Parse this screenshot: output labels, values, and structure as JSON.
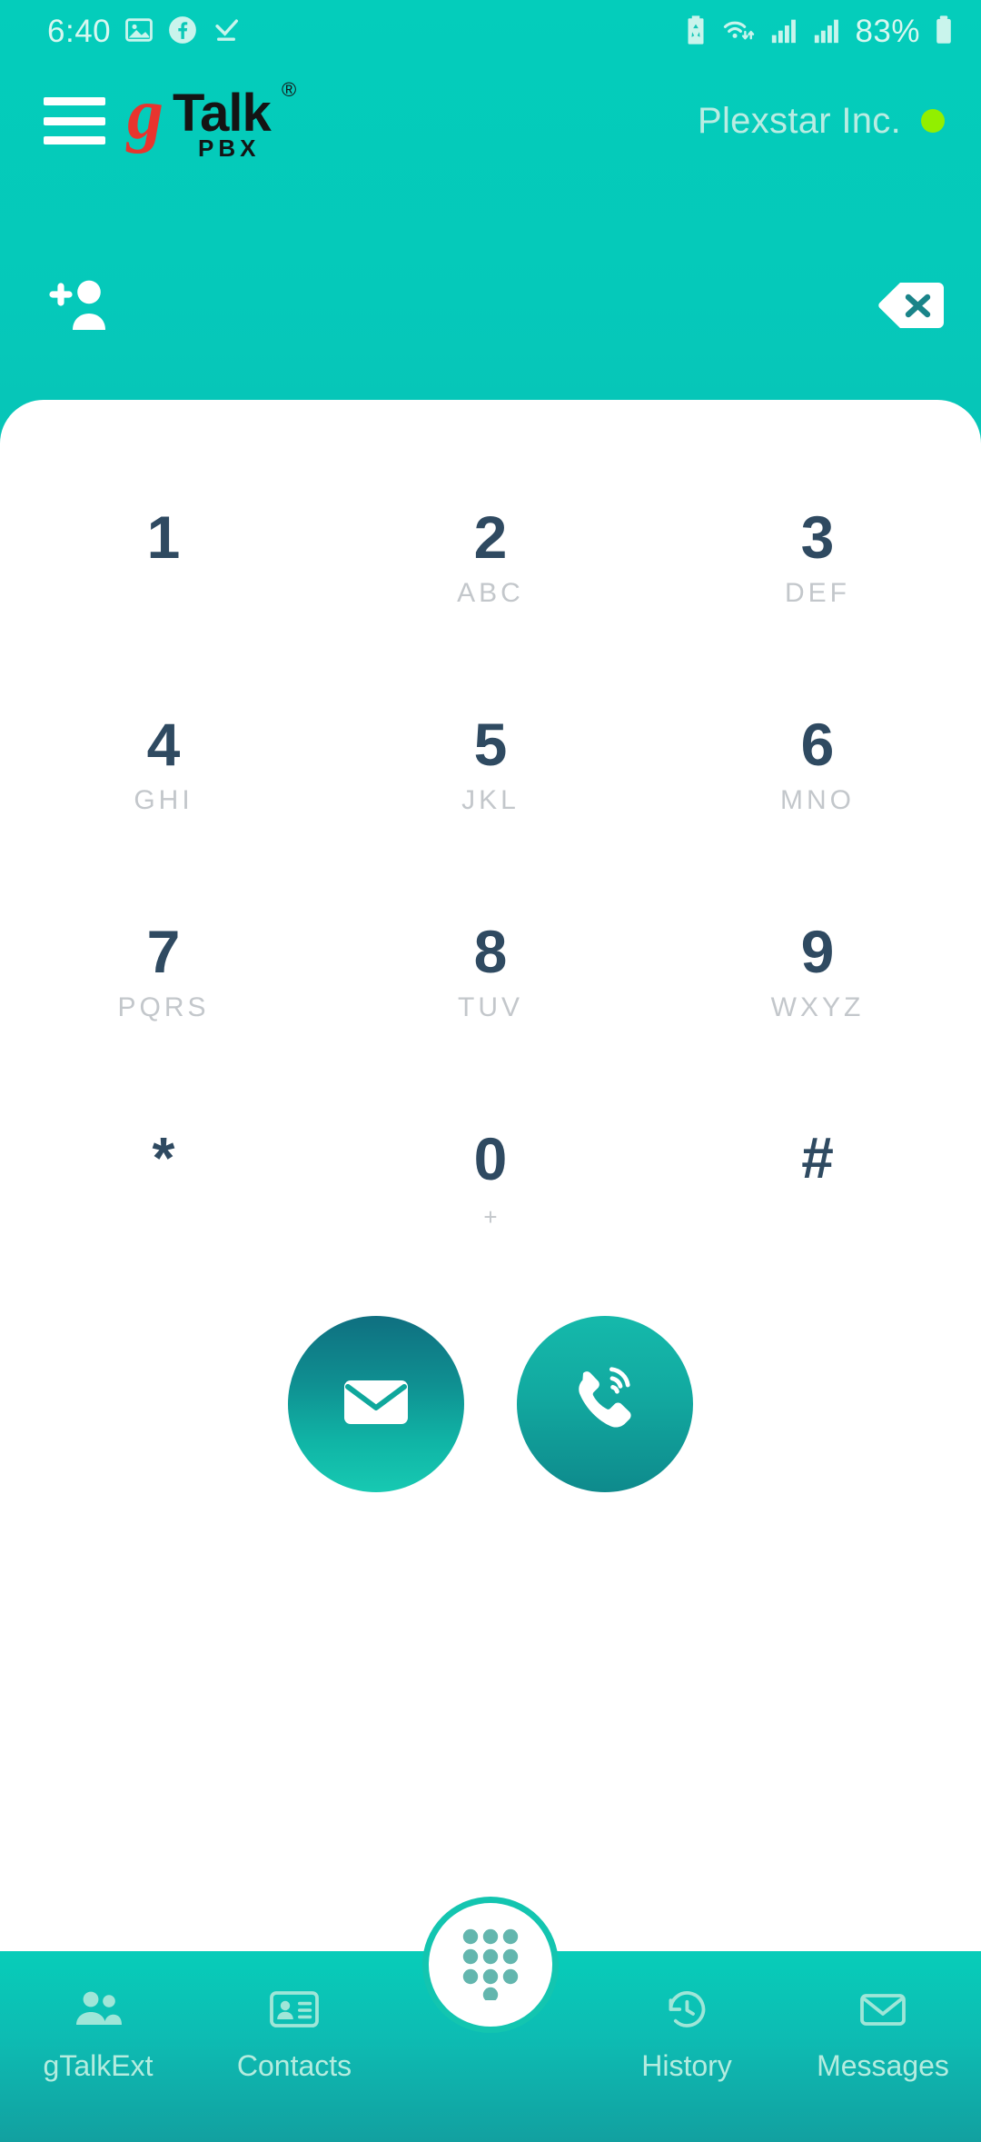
{
  "status_bar": {
    "time": "6:40",
    "battery_percent": "83%",
    "left_icons": [
      "gallery-icon",
      "facebook-icon",
      "download-complete-icon"
    ],
    "right_icons": [
      "battery-saver-icon",
      "wifi-icon",
      "signal-bars-sim1-icon",
      "signal-bars-sim2-icon",
      "battery-icon"
    ],
    "text_color": "#d8f7f0"
  },
  "header": {
    "menu_icon": "hamburger-menu-icon",
    "logo": {
      "g": "g",
      "talk": "Talk",
      "registered": "®",
      "pbx": "PBX",
      "g_color": "#e8342e",
      "text_color": "#141414"
    },
    "company_name": "Plexstar Inc.",
    "status_dot_color": "#92ef00"
  },
  "action_row": {
    "add_contact_icon": "add-person-icon",
    "backspace_icon": "backspace-delete-icon"
  },
  "keypad": {
    "keys": [
      {
        "digit": "1",
        "sub": ""
      },
      {
        "digit": "2",
        "sub": "ABC"
      },
      {
        "digit": "3",
        "sub": "DEF"
      },
      {
        "digit": "4",
        "sub": "GHI"
      },
      {
        "digit": "5",
        "sub": "JKL"
      },
      {
        "digit": "6",
        "sub": "MNO"
      },
      {
        "digit": "7",
        "sub": "PQRS"
      },
      {
        "digit": "8",
        "sub": "TUV"
      },
      {
        "digit": "9",
        "sub": "WXYZ"
      },
      {
        "digit": "*",
        "sub": ""
      },
      {
        "digit": "0",
        "sub": "+"
      },
      {
        "digit": "#",
        "sub": ""
      }
    ],
    "digit_color": "#2f4a61",
    "sub_color": "#c3c7cb"
  },
  "big_actions": {
    "message_icon": "envelope-icon",
    "call_icon": "phone-call-icon"
  },
  "bottom_nav": {
    "items": [
      {
        "label": "gTalkExt",
        "icon": "people-icon"
      },
      {
        "label": "Contacts",
        "icon": "contact-card-icon"
      },
      {
        "label": "Messages",
        "icon": "envelope-outline-icon"
      },
      {
        "label": "History",
        "icon": "history-clock-icon"
      }
    ],
    "center_fab_icon": "dialpad-icon",
    "label_color": "#b4ecdf"
  },
  "theme": {
    "teal_bright": "#04cdbb",
    "teal_dark": "#186f7d",
    "panel_bg": "#ffffff"
  }
}
